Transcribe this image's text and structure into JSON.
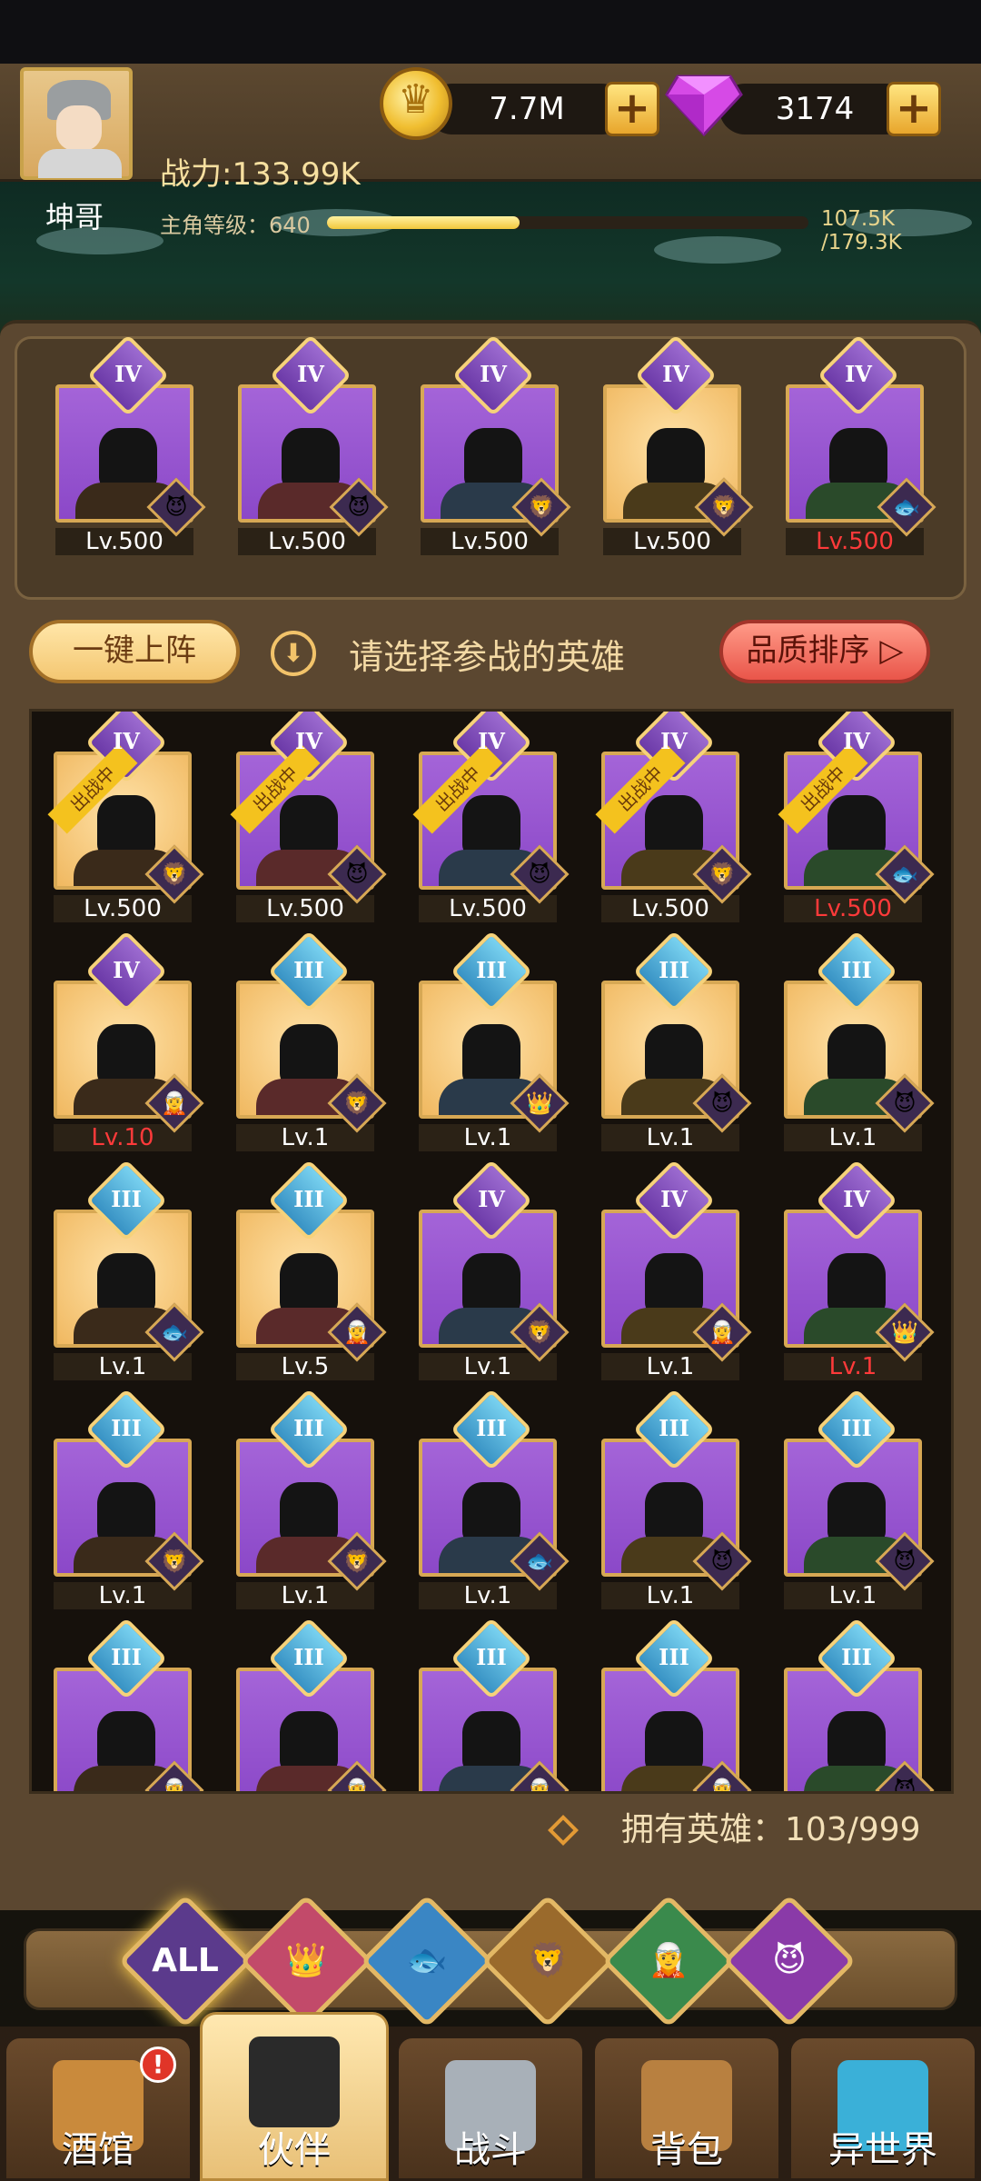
{
  "header": {
    "player_name": "坤哥",
    "power": "战力:133.99K",
    "level": "主角等级：640",
    "xp_text": "107.5K /179.3K",
    "xp_fraction": 0.4,
    "gold": "7.7M",
    "gems": "3174"
  },
  "toolbar": {
    "one_click": "一键上阵",
    "hint": "请选择参战的英雄",
    "sort": "品质排序 ▷"
  },
  "team": [
    {
      "tier": "IV",
      "level": "Lv.500",
      "bg": "purple",
      "faction": "😈",
      "red": false
    },
    {
      "tier": "IV",
      "level": "Lv.500",
      "bg": "purple",
      "faction": "😈",
      "red": false
    },
    {
      "tier": "IV",
      "level": "Lv.500",
      "bg": "purple",
      "faction": "🦁",
      "red": false
    },
    {
      "tier": "IV",
      "level": "Lv.500",
      "bg": "gold",
      "faction": "🦁",
      "red": false
    },
    {
      "tier": "IV",
      "level": "Lv.500",
      "bg": "purple",
      "faction": "🐟",
      "red": true
    }
  ],
  "roster": {
    "deployed_label": "出战中",
    "heroes": [
      {
        "tier": "IV",
        "level": "Lv.500",
        "bg": "gold",
        "faction": "🦁",
        "deployed": true,
        "red": false
      },
      {
        "tier": "IV",
        "level": "Lv.500",
        "bg": "purple",
        "faction": "😈",
        "deployed": true,
        "red": false
      },
      {
        "tier": "IV",
        "level": "Lv.500",
        "bg": "purple",
        "faction": "😈",
        "deployed": true,
        "red": false
      },
      {
        "tier": "IV",
        "level": "Lv.500",
        "bg": "purple",
        "faction": "🦁",
        "deployed": true,
        "red": false
      },
      {
        "tier": "IV",
        "level": "Lv.500",
        "bg": "purple",
        "faction": "🐟",
        "deployed": true,
        "red": true
      },
      {
        "tier": "IV",
        "level": "Lv.10",
        "bg": "gold",
        "faction": "🧝",
        "deployed": false,
        "red": true
      },
      {
        "tier": "III",
        "level": "Lv.1",
        "bg": "gold",
        "faction": "🦁",
        "deployed": false,
        "red": false
      },
      {
        "tier": "III",
        "level": "Lv.1",
        "bg": "gold",
        "faction": "👑",
        "deployed": false,
        "red": false
      },
      {
        "tier": "III",
        "level": "Lv.1",
        "bg": "gold",
        "faction": "😈",
        "deployed": false,
        "red": false
      },
      {
        "tier": "III",
        "level": "Lv.1",
        "bg": "gold",
        "faction": "😈",
        "deployed": false,
        "red": false
      },
      {
        "tier": "III",
        "level": "Lv.1",
        "bg": "gold",
        "faction": "🐟",
        "deployed": false,
        "red": false
      },
      {
        "tier": "III",
        "level": "Lv.5",
        "bg": "gold",
        "faction": "🧝",
        "deployed": false,
        "red": false
      },
      {
        "tier": "IV",
        "level": "Lv.1",
        "bg": "purple",
        "faction": "🦁",
        "deployed": false,
        "red": false
      },
      {
        "tier": "IV",
        "level": "Lv.1",
        "bg": "purple",
        "faction": "🧝",
        "deployed": false,
        "red": false
      },
      {
        "tier": "IV",
        "level": "Lv.1",
        "bg": "purple",
        "faction": "👑",
        "deployed": false,
        "red": true
      },
      {
        "tier": "III",
        "level": "Lv.1",
        "bg": "purple",
        "faction": "🦁",
        "deployed": false,
        "red": false
      },
      {
        "tier": "III",
        "level": "Lv.1",
        "bg": "purple",
        "faction": "🦁",
        "deployed": false,
        "red": false
      },
      {
        "tier": "III",
        "level": "Lv.1",
        "bg": "purple",
        "faction": "🐟",
        "deployed": false,
        "red": false
      },
      {
        "tier": "III",
        "level": "Lv.1",
        "bg": "purple",
        "faction": "😈",
        "deployed": false,
        "red": false
      },
      {
        "tier": "III",
        "level": "Lv.1",
        "bg": "purple",
        "faction": "😈",
        "deployed": false,
        "red": false
      },
      {
        "tier": "III",
        "level": "",
        "bg": "purple",
        "faction": "🧝",
        "deployed": false,
        "red": false
      },
      {
        "tier": "III",
        "level": "",
        "bg": "purple",
        "faction": "🧝",
        "deployed": false,
        "red": false
      },
      {
        "tier": "III",
        "level": "",
        "bg": "purple",
        "faction": "🧝",
        "deployed": false,
        "red": false
      },
      {
        "tier": "III",
        "level": "",
        "bg": "purple",
        "faction": "🧝",
        "deployed": false,
        "red": false
      },
      {
        "tier": "III",
        "level": "",
        "bg": "purple",
        "faction": "😈",
        "deployed": false,
        "red": false
      }
    ]
  },
  "owned": "拥有英雄：103/999",
  "filters": [
    {
      "label": "ALL",
      "color": "#5b3a8c",
      "icon": "all"
    },
    {
      "label": "👑",
      "color": "#c24a6a",
      "icon": "crown-faction-icon"
    },
    {
      "label": "🐟",
      "color": "#3a86c4",
      "icon": "fish-faction-icon"
    },
    {
      "label": "🦁",
      "color": "#9a6a2c",
      "icon": "lion-faction-icon"
    },
    {
      "label": "🧝",
      "color": "#3a8a4c",
      "icon": "elf-faction-icon"
    },
    {
      "label": "😈",
      "color": "#8a3aa8",
      "icon": "demon-faction-icon"
    }
  ],
  "nav": [
    {
      "label": "酒馆",
      "icon": "tavern-icon",
      "color": "#c98a3c"
    },
    {
      "label": "伙伴",
      "icon": "partner-icon",
      "color": "#2a2a2a"
    },
    {
      "label": "战斗",
      "icon": "battle-icon",
      "color": "#a8b0b8"
    },
    {
      "label": "背包",
      "icon": "backpack-icon",
      "color": "#b88040"
    },
    {
      "label": "异世界",
      "icon": "otherworld-icon",
      "color": "#3ab0d8"
    }
  ],
  "nav_badge": "!"
}
